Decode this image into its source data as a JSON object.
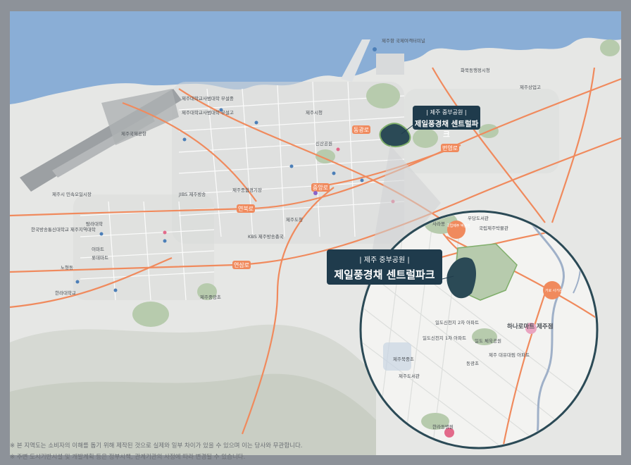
{
  "regions": {
    "airport": "제주국제공항",
    "cruise_terminal": "제주항 국제여객터미널",
    "hwabuk": "화북동행정시청",
    "jeju_science": "제주상업고",
    "jeju_univ_hs": "제주대학교사범대학 부설중",
    "jeju_univ_ms": "제주대학교사범대학 부설고",
    "jeju_city_hall": "제주시청",
    "civic_park": "신산공원",
    "jeju_sports": "제주종합경기장",
    "jibs": "JIBS 제주방송",
    "kbs": "KBS 제주방송총국",
    "jeju_hall": "제주도청",
    "jeju_folk": "제주시 민속오일시장",
    "tamna": "탐라대학",
    "korea_broadcast": "한국방송통신대학교 제주지역대학",
    "emart": "이마트",
    "lotte": "롯데마트",
    "nohyeong": "노형동",
    "halla_univ": "한라대학교",
    "jeju_nat_museum": "국립제주박물관",
    "hanaro": "하나로마트",
    "ildo_apt": "일도신천지 아파트",
    "jeju_central_ps": "제주중앙초",
    "halla_hospital": "한라병원"
  },
  "road_tags": [
    "동광로",
    "연북로",
    "중앙로",
    "연삼로",
    "번영로",
    "연북로"
  ],
  "inset_labels": {
    "sarabong": "사라봉",
    "usadang": "우당도서관",
    "museum": "국립제주 박물관",
    "museum2": "국립제주박물관",
    "intersection": "거로 사거리",
    "ildo_sinchon_2": "일도신천지 2차 아파트",
    "ildo_sinchon_1": "일도신천지 1차 아파트",
    "ildo_gym": "일도 체육공원",
    "hanaro_mart": "하나로마트 제주점",
    "daelim_apt": "제주 대유대림 아파트",
    "jeju_ms": "제주북중초",
    "jeju_library": "제주도서관",
    "dongkwang": "동광초",
    "halla_hospital": "한라동병원"
  },
  "callout_small": {
    "sub": "| 제주 중부공원 |",
    "main": "제일풍경채 센트럴파크"
  },
  "callout_big": {
    "sub": "| 제주 중부공원 |",
    "main": "제일풍경채 센트럴파크"
  },
  "disclaimer": [
    "※ 본 지역도는 소비자의 이해를 돕기 위해 제작된 것으로 실제와 일부 차이가 있을 수 있으며 이는 당사와 무관합니다.",
    "※ 주변 도시기반시설 및 개발계획 등은 정부시책, 관계기관의 사정에 따라 변경될 수 있습니다."
  ],
  "colors": {
    "sea": "#8aaed6",
    "land": "#e6e7e5",
    "road_major": "#f08a5d",
    "park": "#b7cbad",
    "callout": "#1f3b4c",
    "site": "#2b4a56",
    "frame": "#8d9299"
  }
}
